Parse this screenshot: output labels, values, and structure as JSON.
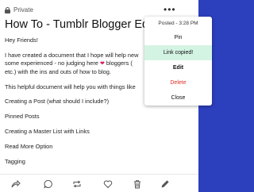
{
  "post": {
    "privacy_label": "Private",
    "title": "How To - Tumblr Blogger Editio",
    "greeting": "Hey Friends!",
    "paragraph1_line1": "I have created a document that I hope will help new",
    "paragraph1_line2": "some experienced - no judging here",
    "paragraph1_line2_after": "bloggers (",
    "paragraph1_line3": "etc.) with the ins and outs of how to blog.",
    "paragraph2": "This helpful document will help you with things like",
    "sections": [
      "Creating a Post (what should I include?)",
      "Pinned Posts",
      "Creating a Master List with Links",
      "Read More Option",
      "Tagging"
    ]
  },
  "menu": {
    "posted": "Posted - 3:28 PM",
    "items": {
      "pin": "Pin",
      "link_copied": "Link copied!",
      "edit": "Edit",
      "delete": "Delete",
      "close": "Close"
    }
  },
  "icons": {
    "more": "more-options-icon",
    "share": "share-icon",
    "reply": "reply-icon",
    "reblog": "reblog-icon",
    "like": "heart-icon",
    "delete": "trash-icon",
    "edit": "pencil-icon"
  },
  "colors": {
    "background": "#2c3fbd",
    "copied_highlight": "#d4f4e3",
    "delete": "#e0302a"
  }
}
